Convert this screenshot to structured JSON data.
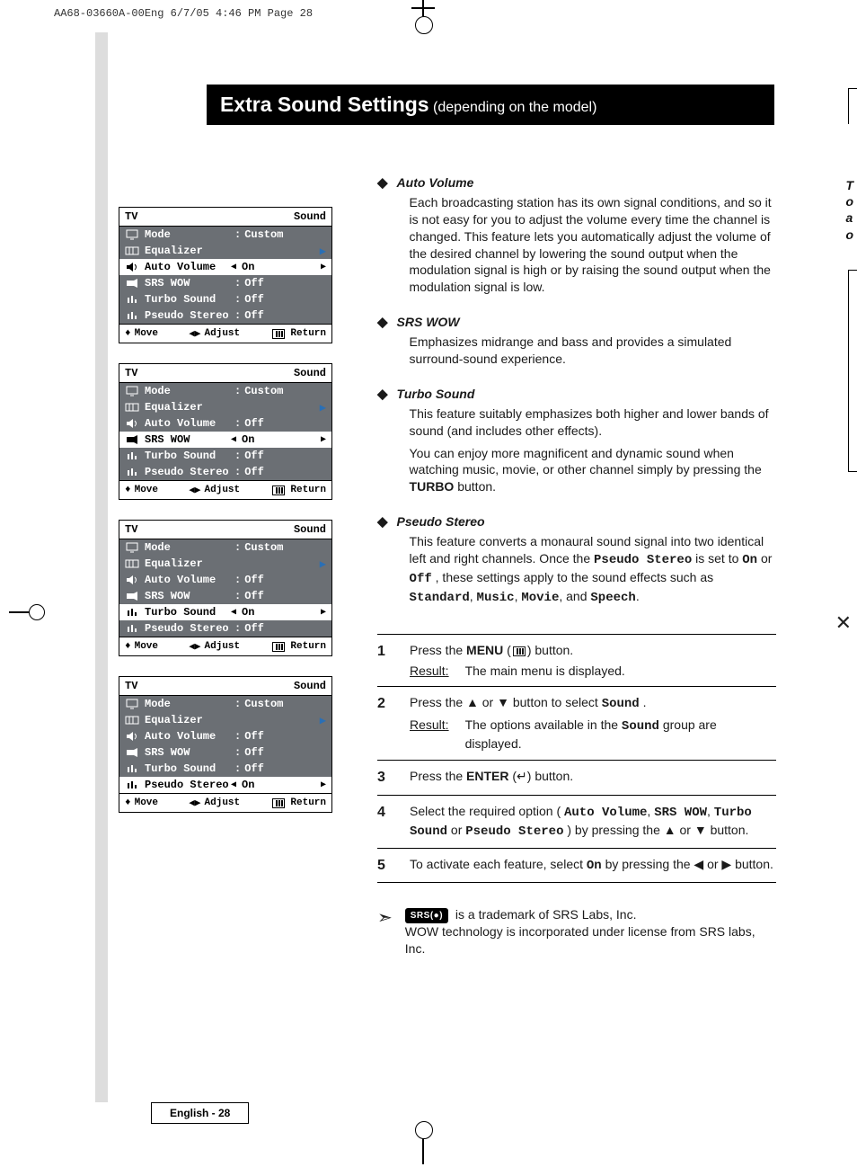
{
  "header_line": "AA68-03660A-00Eng  6/7/05  4:46 PM  Page 28",
  "title_main": "Extra Sound Settings",
  "title_sub": "(depending on the model)",
  "edge_text": [
    "T",
    "o",
    "a",
    "o"
  ],
  "menus": [
    {
      "title_left": "TV",
      "title_right": "Sound",
      "rows": [
        {
          "label": "Mode",
          "sep": ":",
          "val": "Custom"
        },
        {
          "label": "Equalizer",
          "val_arrow_right": true
        },
        {
          "label": "Auto Volume",
          "active": true,
          "val": "On",
          "arrows": true
        },
        {
          "label": "SRS WOW",
          "sep": ":",
          "val": "Off"
        },
        {
          "label": "Turbo Sound",
          "sep": ":",
          "val": "Off"
        },
        {
          "label": "Pseudo Stereo",
          "sep": ":",
          "val": "Off"
        }
      ],
      "foot": {
        "move": "Move",
        "adjust": "Adjust",
        "return": "Return"
      }
    },
    {
      "title_left": "TV",
      "title_right": "Sound",
      "rows": [
        {
          "label": "Mode",
          "sep": ":",
          "val": "Custom"
        },
        {
          "label": "Equalizer",
          "val_arrow_right": true
        },
        {
          "label": "Auto Volume",
          "sep": ":",
          "val": "Off"
        },
        {
          "label": "SRS WOW",
          "active": true,
          "val": "On",
          "arrows": true
        },
        {
          "label": "Turbo Sound",
          "sep": ":",
          "val": "Off"
        },
        {
          "label": "Pseudo Stereo",
          "sep": ":",
          "val": "Off"
        }
      ],
      "foot": {
        "move": "Move",
        "adjust": "Adjust",
        "return": "Return"
      }
    },
    {
      "title_left": "TV",
      "title_right": "Sound",
      "rows": [
        {
          "label": "Mode",
          "sep": ":",
          "val": "Custom"
        },
        {
          "label": "Equalizer",
          "val_arrow_right": true
        },
        {
          "label": "Auto Volume",
          "sep": ":",
          "val": "Off"
        },
        {
          "label": "SRS WOW",
          "sep": ":",
          "val": "Off"
        },
        {
          "label": "Turbo Sound",
          "active": true,
          "val": "On",
          "arrows": true
        },
        {
          "label": "Pseudo Stereo",
          "sep": ":",
          "val": "Off"
        }
      ],
      "foot": {
        "move": "Move",
        "adjust": "Adjust",
        "return": "Return"
      }
    },
    {
      "title_left": "TV",
      "title_right": "Sound",
      "rows": [
        {
          "label": "Mode",
          "sep": ":",
          "val": "Custom"
        },
        {
          "label": "Equalizer",
          "val_arrow_right": true
        },
        {
          "label": "Auto Volume",
          "sep": ":",
          "val": "Off"
        },
        {
          "label": "SRS WOW",
          "sep": ":",
          "val": "Off"
        },
        {
          "label": "Turbo Sound",
          "sep": ":",
          "val": "Off"
        },
        {
          "label": "Pseudo Stereo",
          "active": true,
          "val": "On",
          "arrows": true
        }
      ],
      "foot": {
        "move": "Move",
        "adjust": "Adjust",
        "return": "Return"
      }
    }
  ],
  "features": {
    "auto_volume": {
      "h": "Auto Volume",
      "p": "Each broadcasting station has its own signal conditions, and so it is not easy for you to adjust the volume every time the channel is changed. This feature lets you automatically adjust the volume of the desired channel by lowering the sound output when the modulation signal is high or by raising the sound output when the modulation signal is low."
    },
    "srs_wow": {
      "h": "SRS WOW",
      "p": "Emphasizes midrange and bass and provides a simulated surround-sound experience."
    },
    "turbo_sound": {
      "h": "Turbo Sound",
      "p1": "This feature suitably emphasizes both higher and lower bands of sound (and includes other effects).",
      "p2a": "You can enjoy more magnificent and dynamic sound when watching music, movie, or other channel simply by pressing the ",
      "p2_btn": "TURBO",
      "p2b": " button."
    },
    "pseudo_stereo": {
      "h": "Pseudo Stereo",
      "p_pre": "This feature converts a monaural sound signal into two identical left and right channels. Once the ",
      "ps": "Pseudo Stereo",
      "p_mid": " is set to ",
      "on": "On",
      "or": " or ",
      "off": "Off",
      "p_mid2": ", these settings apply to the sound effects such as ",
      "s1": "Standard",
      "c": ", ",
      "s2": "Music",
      "s3": "Movie",
      "and": ", and ",
      "s4": "Speech",
      "dot": "."
    }
  },
  "steps": {
    "s1": {
      "num": "1",
      "a": "Press the ",
      "menu": "MENU",
      "b": " (",
      "c": ") button.",
      "result_label": "Result:",
      "result": "The main menu is displayed."
    },
    "s2": {
      "num": "2",
      "a": "Press the ▲ or ▼ button to select ",
      "sound": "Sound",
      "b": ".",
      "result_label": "Result:",
      "result_a": "The options available in the ",
      "result_sound": "Sound",
      "result_b": " group are displayed."
    },
    "s3": {
      "num": "3",
      "a": "Press the ",
      "enter": "ENTER",
      "b": " (",
      "c": ") button."
    },
    "s4": {
      "num": "4",
      "a": "Select the required option (",
      "o1": "Auto Volume",
      "c1": ", ",
      "o2": "SRS WOW",
      "c2": ", ",
      "o3": "Turbo Sound",
      "or": " or ",
      "o4": "Pseudo Stereo",
      "b": ") by pressing the ▲ or ▼ button."
    },
    "s5": {
      "num": "5",
      "a": "To activate each feature, select ",
      "on": "On",
      "b": " by pressing the ◀ or ▶ button."
    }
  },
  "srs_note": {
    "logo": "SRS(●)",
    "line1": " is a trademark of SRS Labs, Inc.",
    "line2": "WOW technology is incorporated under license from SRS labs, Inc."
  },
  "footer": "English - 28"
}
